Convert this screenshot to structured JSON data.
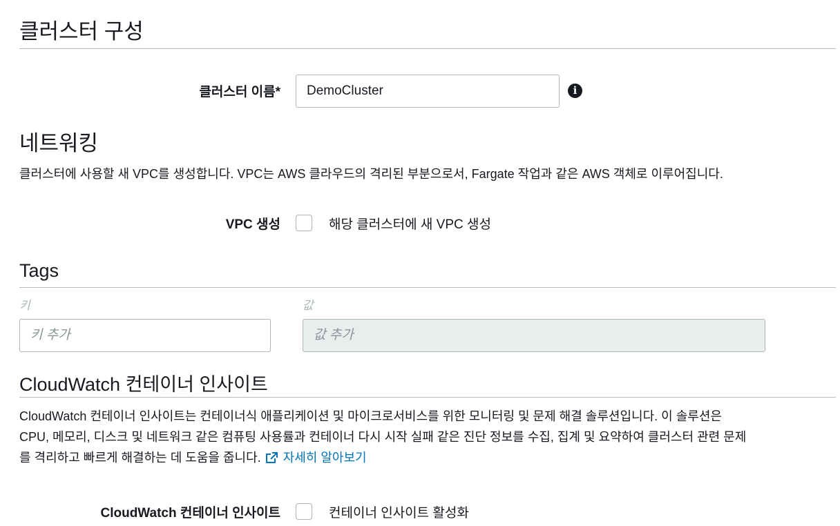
{
  "cluster_config": {
    "title": "클러스터 구성",
    "name_label": "클러스터 이름*",
    "name_value": "DemoCluster",
    "info_icon": "info-icon"
  },
  "networking": {
    "title": "네트워킹",
    "description": "클러스터에 사용할 새 VPC를 생성합니다. VPC는 AWS 클라우드의 격리된 부분으로서, Fargate 작업과 같은 AWS 객체로 이루어집니다.",
    "vpc_label": "VPC 생성",
    "vpc_checkbox_label": "해당 클러스터에 새 VPC 생성",
    "vpc_checked": false
  },
  "tags": {
    "title": "Tags",
    "key_column": "키",
    "value_column": "값",
    "key_placeholder": "키 추가",
    "value_placeholder": "값 추가"
  },
  "cloudwatch": {
    "title": "CloudWatch 컨테이너 인사이트",
    "description_line1": "CloudWatch 컨테이너 인사이트는 컨테이너식 애플리케이션 및 마이크로서비스를 위한 모니터링 및 문제 해결 솔루션입니다. 이 솔루션은",
    "description_line2": "CPU, 메모리, 디스크 및 네트워크 같은 컴퓨팅 사용률과 컨테이너 다시 시작 실패 같은 진단 정보를 수집, 집계 및 요약하여 클러스터 관련 문제",
    "description_line3": "를 격리하고 빠르게 해결하는 데 도움을 줍니다.",
    "learn_more": "자세히 알아보기",
    "learn_more_icon": "external-link-icon",
    "insights_label": "CloudWatch 컨테이너 인사이트",
    "insights_checkbox_label": "컨테이너 인사이트 활성화",
    "insights_checked": false
  },
  "colors": {
    "link": "#0073bb",
    "text": "#16191f",
    "border": "#aab7b8",
    "disabled_bg": "#eaeded"
  }
}
